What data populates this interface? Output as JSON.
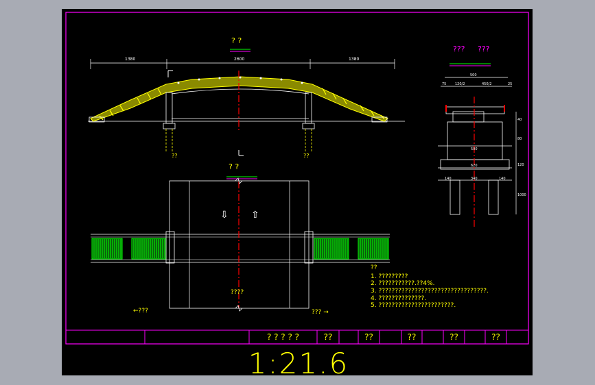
{
  "drawing": {
    "elevation_title": "? ?",
    "section_title_left": "???",
    "section_title_right": "???",
    "plan_title": "? ?",
    "dim_left": "1380",
    "dim_center": "2600",
    "dim_right": "1380",
    "section_dims": {
      "top": "500",
      "l1": "75",
      "l2": "120/2",
      "r2": "450/2",
      "r1": "25",
      "mid": "500",
      "base": "620",
      "p1": "140",
      "p2": "340",
      "p3": "140",
      "h1": "40",
      "h2": "80",
      "h3": "120",
      "h4": "1000"
    },
    "pier_mark_left": "??",
    "pier_mark_right": "??",
    "plan_center_label": "????",
    "plan_left_dir": "←???",
    "plan_right_dir": "??? →",
    "arrow_down": "⇩",
    "arrow_up": "⇧"
  },
  "notes": {
    "heading": "??",
    "items": [
      "1. ?????????",
      "2. ???????????.??4%.",
      "3. ?????????????????????????????????.",
      "4. ??????????????.",
      "5. ???????????????????????."
    ]
  },
  "title_block": {
    "cells": [
      "? ? ? ? ?",
      "??",
      "??",
      "??",
      "??",
      "??"
    ]
  },
  "scale": "1:21.6",
  "colors": {
    "frame": "#ff00ff",
    "structure": "#ffff00",
    "steps": "#00ff00",
    "centerline": "#ff0000",
    "background": "#000000"
  }
}
